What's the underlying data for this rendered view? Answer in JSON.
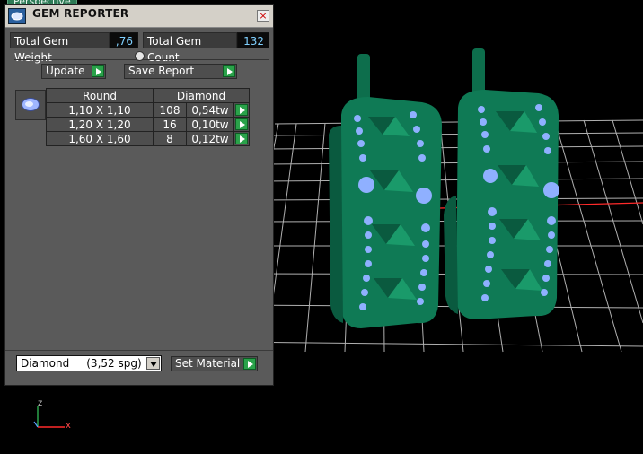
{
  "viewport": {
    "tab_label": "Perspective",
    "axis_x": "x",
    "axis_z": "z"
  },
  "panel": {
    "title": "GEM REPORTER",
    "close_glyph": "×",
    "total_weight_label": "Total Gem Weight",
    "total_weight_value": ",76",
    "total_count_label": "Total Gem Count",
    "total_count_value": "132",
    "update_label": "Update",
    "save_report_label": "Save Report",
    "table": {
      "headers": [
        "Round",
        "Diamond"
      ],
      "rows": [
        {
          "size": "1,10 X 1,10",
          "count": "108",
          "weight": "0,54tw"
        },
        {
          "size": "1,20 X 1,20",
          "count": "16",
          "weight": "0,10tw"
        },
        {
          "size": "1,60 X 1,60",
          "count": "8",
          "weight": "0,12tw"
        }
      ]
    },
    "material_selected": "Diamond     (3,52 spg)",
    "set_material_label": "Set Material"
  },
  "icons": {
    "title_icon": "gem-reporter-icon",
    "close": "close-icon",
    "play": "play-arrow-icon",
    "gem": "round-gem-icon",
    "dropdown": "chevron-down-icon"
  },
  "colors": {
    "model_green": "#0f7a55",
    "gem_blue": "#8fb0ff",
    "grid": "#d0d0d0",
    "accent_red": "#ff2a2a",
    "button_green": "#2aa24a"
  }
}
